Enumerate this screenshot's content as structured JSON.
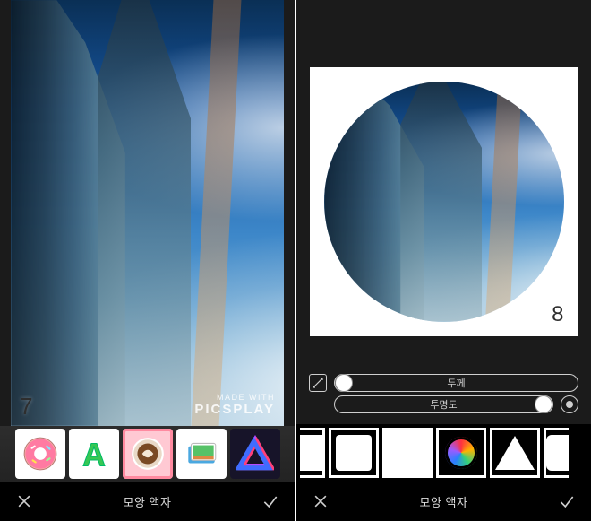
{
  "left": {
    "stepNumber": "7",
    "watermarkTop": "MADE WITH",
    "watermarkBrand": "PICSPLAY",
    "thumbs": [
      {
        "id": "shape-donut",
        "selected": false
      },
      {
        "id": "shape-letter-a",
        "selected": false
      },
      {
        "id": "shape-coffee",
        "selected": true
      },
      {
        "id": "shape-stack",
        "selected": false
      },
      {
        "id": "shape-penrose",
        "selected": false
      }
    ],
    "bottomTitle": "모양 액자"
  },
  "right": {
    "stepNumber": "8",
    "sliders": {
      "thickness": {
        "label": "두께",
        "value": 0
      },
      "opacity": {
        "label": "투명도",
        "value": 100
      }
    },
    "shapes": [
      {
        "id": "partial-left",
        "variant": "half"
      },
      {
        "id": "shape-square",
        "variant": "square"
      },
      {
        "id": "shape-full",
        "variant": "full"
      },
      {
        "id": "shape-rgb",
        "variant": "rgb",
        "selected": true
      },
      {
        "id": "shape-triangle",
        "variant": "triangle"
      },
      {
        "id": "partial-right",
        "variant": "half-right"
      }
    ],
    "bottomTitle": "모양 액자"
  }
}
